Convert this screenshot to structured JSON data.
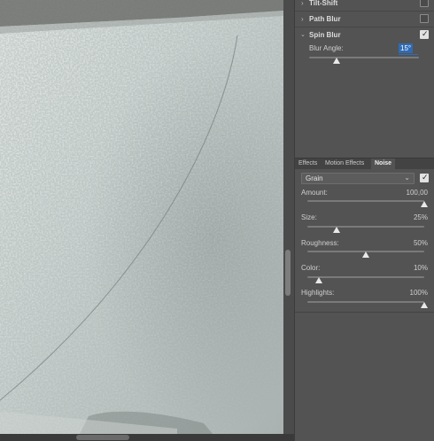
{
  "blur_gallery": {
    "items": [
      {
        "label": "Tilt-Shift",
        "expanded": false,
        "checked": false
      },
      {
        "label": "Path Blur",
        "expanded": false,
        "checked": false
      },
      {
        "label": "Spin Blur",
        "expanded": true,
        "checked": true
      }
    ],
    "spin_blur": {
      "angle_label": "Blur Angle:",
      "angle_value": "15°",
      "angle_slider_fraction": 0.25
    }
  },
  "effects_panel": {
    "tabs": [
      {
        "label": "Effects",
        "active": false
      },
      {
        "label": "Motion Effects",
        "active": false
      },
      {
        "label": "Noise",
        "active": true
      }
    ],
    "noise": {
      "type_selected": "Grain",
      "enabled": true,
      "sliders": [
        {
          "label": "Amount:",
          "value": "100,00",
          "fraction": 1.0
        },
        {
          "label": "Size:",
          "value": "25%",
          "fraction": 0.25
        },
        {
          "label": "Roughness:",
          "value": "50%",
          "fraction": 0.5
        },
        {
          "label": "Color:",
          "value": "10%",
          "fraction": 0.1
        },
        {
          "label": "Highlights:",
          "value": "100%",
          "fraction": 1.0
        }
      ]
    }
  },
  "icons": {
    "expand_chevron": "chevron-right-icon",
    "collapse_chevron": "chevron-down-icon",
    "dropdown": "chevron-down-icon",
    "check": "checkmark-icon"
  },
  "colors": {
    "panel_bg": "#535353",
    "selection_blue": "#2f6bb4",
    "canvas_tone": "#bcc5c3"
  }
}
